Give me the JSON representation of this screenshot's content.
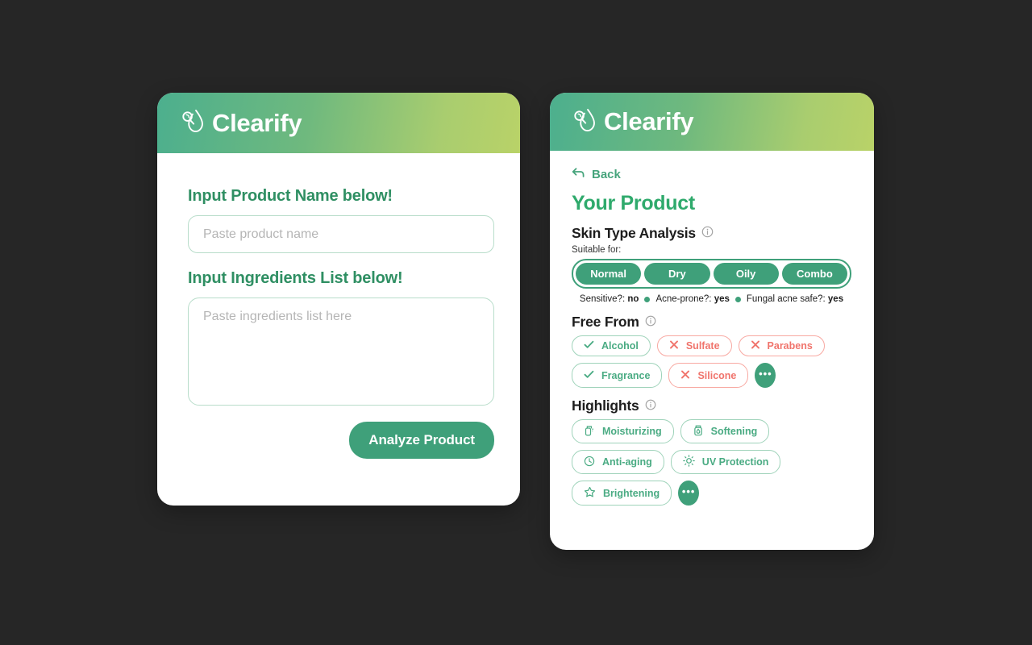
{
  "app": {
    "brand_name": "Clearify",
    "logo_icon": "droplet-magnifier-icon",
    "accent_green": "#3fa07a",
    "title_green": "#2faa6c",
    "label_green": "#2f8f63",
    "danger_red": "#f0746c",
    "page_background": "#262626"
  },
  "input_card": {
    "product_name": {
      "label": "Input Product Name below!",
      "placeholder": "Paste product name",
      "value": ""
    },
    "ingredients": {
      "label": "Input Ingredients List below!",
      "placeholder": "Paste ingredients list here",
      "value": ""
    },
    "submit_label": "Analyze Product"
  },
  "result_card": {
    "back_label": "Back",
    "back_icon": "arrow-back-icon",
    "title": "Your Product",
    "skin_type": {
      "heading": "Skin Type Analysis",
      "info_icon": "info-icon",
      "sub_label": "Suitable for:",
      "options": [
        {
          "label": "Normal",
          "selected": true
        },
        {
          "label": "Dry",
          "selected": true
        },
        {
          "label": "Oily",
          "selected": true
        },
        {
          "label": "Combo",
          "selected": true
        }
      ],
      "flags": [
        {
          "label": "Sensitive?:",
          "value": "no"
        },
        {
          "label": "Acne-prone?:",
          "value": "yes"
        },
        {
          "label": "Fungal acne safe?:",
          "value": "yes"
        }
      ]
    },
    "free_from": {
      "heading": "Free From",
      "info_icon": "info-icon",
      "chips": [
        {
          "label": "Alcohol",
          "state": "good",
          "icon": "check-icon"
        },
        {
          "label": "Sulfate",
          "state": "bad",
          "icon": "cross-icon"
        },
        {
          "label": "Parabens",
          "state": "bad",
          "icon": "cross-icon"
        },
        {
          "label": "Fragrance",
          "state": "good",
          "icon": "check-icon"
        },
        {
          "label": "Silicone",
          "state": "bad",
          "icon": "cross-icon"
        }
      ],
      "more_label": "•••"
    },
    "highlights": {
      "heading": "Highlights",
      "info_icon": "info-icon",
      "chips": [
        {
          "label": "Moisturizing",
          "icon": "pump-bottle-icon"
        },
        {
          "label": "Softening",
          "icon": "cream-tube-icon"
        },
        {
          "label": "Anti-aging",
          "icon": "clock-icon"
        },
        {
          "label": "UV Protection",
          "icon": "sun-icon"
        },
        {
          "label": "Brightening",
          "icon": "star-icon"
        }
      ],
      "more_label": "•••"
    }
  }
}
